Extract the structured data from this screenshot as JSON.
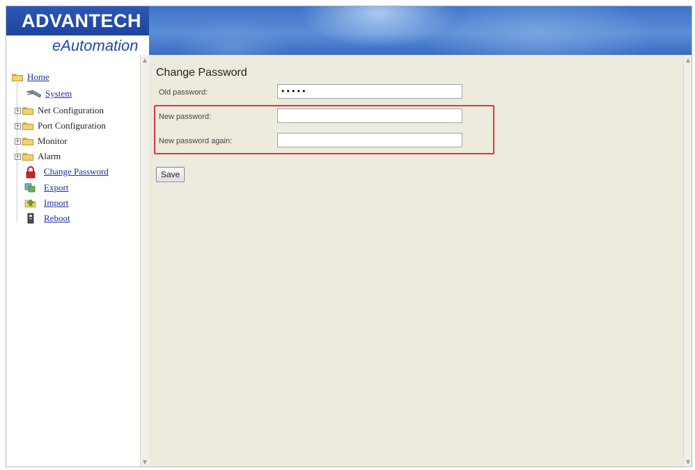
{
  "header": {
    "logo_text": "ADVANTECH",
    "tagline": "eAutomation"
  },
  "sidebar": {
    "items": [
      {
        "label": "Home",
        "icon": "folder-open-icon",
        "link": true
      },
      {
        "label": "System",
        "icon": "network-cable-icon",
        "link": true
      },
      {
        "label": "Net Configuration",
        "icon": "folder-icon",
        "link": false,
        "expandable": true
      },
      {
        "label": "Port Configuration",
        "icon": "folder-icon",
        "link": false,
        "expandable": true
      },
      {
        "label": "Monitor",
        "icon": "folder-icon",
        "link": false,
        "expandable": true
      },
      {
        "label": "Alarm",
        "icon": "folder-icon",
        "link": false,
        "expandable": true
      },
      {
        "label": "Change Password",
        "icon": "lock-icon",
        "link": true
      },
      {
        "label": "Export",
        "icon": "export-icon",
        "link": true
      },
      {
        "label": "Import",
        "icon": "import-icon",
        "link": true
      },
      {
        "label": "Reboot",
        "icon": "reboot-icon",
        "link": true
      }
    ],
    "expand_glyph": "+"
  },
  "form": {
    "title": "Change Password",
    "old_label": "Old password:",
    "old_value": "•••••",
    "new_label": "New password:",
    "new_value": "",
    "again_label": "New password again:",
    "again_value": "",
    "save_label": "Save"
  },
  "colors": {
    "brand_blue": "#1f48a8",
    "panel_bg": "#ecebdd",
    "highlight_red": "#d9383a",
    "link_blue": "#1a2fa0"
  }
}
